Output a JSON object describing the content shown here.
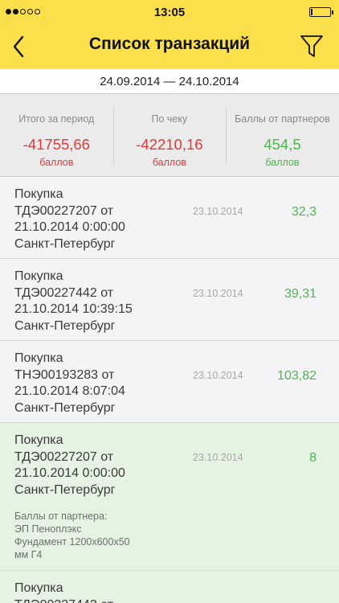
{
  "status": {
    "time": "13:05",
    "signal_filled": 2,
    "signal_total": 5,
    "battery_level": 0.1
  },
  "nav": {
    "title": "Список транзакций",
    "back_icon": "chevron-left-icon",
    "filter_icon": "filter-icon"
  },
  "period": "24.09.2014 — 24.10.2014",
  "summary": [
    {
      "label": "Итого за период",
      "value": "-41755,66",
      "unit": "баллов",
      "color": "#e13b3b"
    },
    {
      "label": "По чеку",
      "value": "-42210,16",
      "unit": "баллов",
      "color": "#e13b3b"
    },
    {
      "label": "Баллы от партнеров",
      "value": "454,5",
      "unit": "баллов",
      "color": "#4db64d"
    }
  ],
  "transactions": [
    {
      "title": "Покупка\nТДЭ00227207 от\n21.10.2014 0:00:00\nСанкт-Петербург",
      "date": "23.10.2014",
      "amount": "32,3"
    },
    {
      "title": "Покупка\nТДЭ00227442 от\n21.10.2014 10:39:15\nСанкт-Петербург",
      "date": "23.10.2014",
      "amount": "39,31"
    },
    {
      "title": "Покупка\nТНЭ00193283 от\n21.10.2014 8:07:04\nСанкт-Петербург",
      "date": "23.10.2014",
      "amount": "103,82"
    },
    {
      "title": "Покупка\nТДЭ00227207 от\n21.10.2014 0:00:00\nСанкт-Петербург",
      "date": "23.10.2014",
      "amount": "8",
      "note": "Баллы от партнера:\nЭП  Пеноплэкс\nФундамент  1200x600x50\nмм Г4"
    },
    {
      "title": "Покупка\nТДЭ00227442 от"
    }
  ],
  "colors": {
    "accent_yellow": "#fbe04b",
    "negative": "#e13b3b",
    "positive": "#4db64d",
    "highlight_row": "#e5f3e2"
  }
}
